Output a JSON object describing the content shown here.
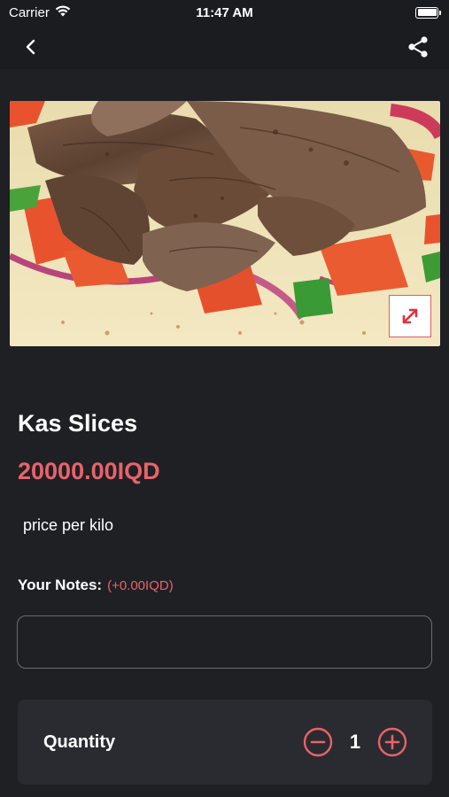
{
  "status_bar": {
    "carrier": "Carrier",
    "time": "11:47 AM",
    "battery_level": 1.0
  },
  "nav": {
    "back_icon": "chevron-left-icon",
    "share_icon": "share-icon"
  },
  "product": {
    "image_alt": "kebab-meat-photo",
    "expand_icon": "expand-arrows-icon",
    "name": "Kas Slices",
    "price": "20000.00IQD",
    "description": "price per kilo"
  },
  "notes": {
    "label": "Your Notes:",
    "extra_price": "(+0.00IQD)",
    "value": "",
    "placeholder": ""
  },
  "quantity": {
    "label": "Quantity",
    "value": "1",
    "minus_icon": "minus-circle-icon",
    "plus_icon": "plus-circle-icon"
  },
  "colors": {
    "background": "#1f2024",
    "accent": "#e8636b",
    "card": "#2a2b30"
  }
}
